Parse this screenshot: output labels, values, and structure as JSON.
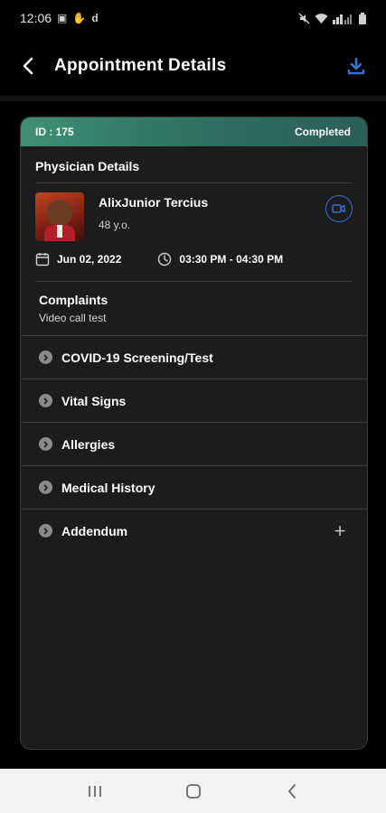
{
  "status_bar": {
    "time": "12:06",
    "left_icons": [
      "image-icon",
      "hand-icon",
      "d-app-icon"
    ],
    "right_icons": [
      "mute-icon",
      "wifi-icon",
      "signal-icon",
      "battery-icon"
    ]
  },
  "header": {
    "title": "Appointment Details",
    "download_icon": "download-icon",
    "back_icon": "back-arrow-icon"
  },
  "card": {
    "id_label": "ID : 175",
    "status": "Completed",
    "physician_section_title": "Physician Details",
    "physician": {
      "name": "AlixJunior Tercius",
      "age": "48 y.o."
    },
    "date": "Jun 02, 2022",
    "time_range": "03:30 PM - 04:30 PM",
    "complaints_title": "Complaints",
    "complaints_text": "Video call test",
    "sections": [
      {
        "label": "COVID-19 Screening/Test"
      },
      {
        "label": "Vital Signs"
      },
      {
        "label": "Allergies"
      },
      {
        "label": "Medical History"
      },
      {
        "label": "Addendum",
        "action": "+"
      }
    ]
  },
  "colors": {
    "header_gradient_start": "#3f8f75",
    "header_gradient_end": "#2a5f57",
    "accent_blue": "#3a6fd8",
    "background": "#000000",
    "card_background": "#1c1c1c"
  }
}
